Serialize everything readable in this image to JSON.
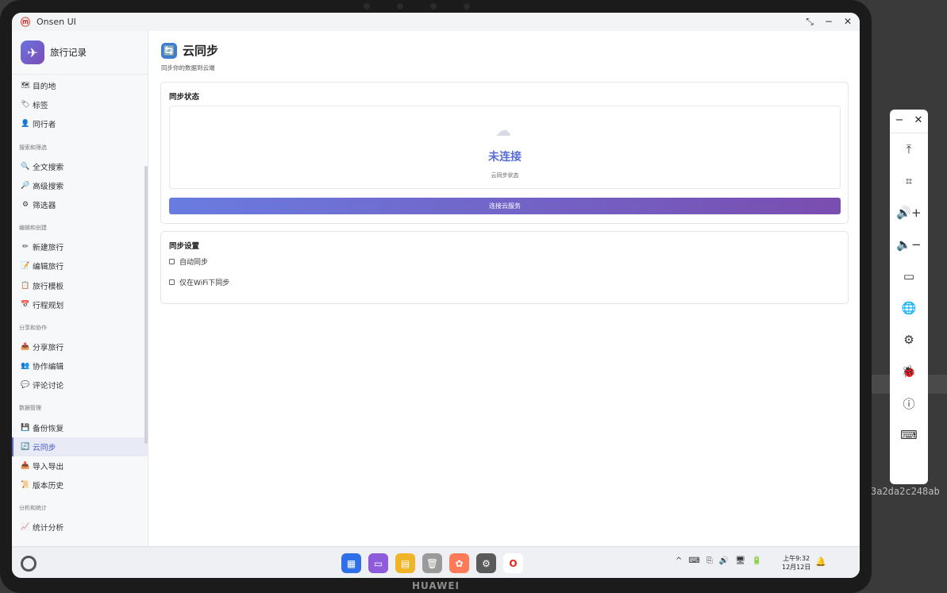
{
  "device": {
    "brand": "HUAWEI"
  },
  "window": {
    "title": "Onsen UI",
    "controls": [
      "⤡",
      "−",
      "✕"
    ]
  },
  "sidebar": {
    "app_title": "旅行记录",
    "sections": [
      {
        "label": "",
        "items": [
          {
            "icon": "🗺",
            "label": "目的地"
          },
          {
            "icon": "🏷",
            "label": "标签"
          },
          {
            "icon": "👤",
            "label": "同行者"
          }
        ]
      },
      {
        "label": "搜索和筛选",
        "items": [
          {
            "icon": "🔍",
            "label": "全文搜索"
          },
          {
            "icon": "🔎",
            "label": "高级搜索"
          },
          {
            "icon": "⚙",
            "label": "筛选器"
          }
        ]
      },
      {
        "label": "编辑和创建",
        "items": [
          {
            "icon": "✏",
            "label": "新建旅行"
          },
          {
            "icon": "📝",
            "label": "编辑旅行"
          },
          {
            "icon": "📋",
            "label": "旅行模板"
          },
          {
            "icon": "📅",
            "label": "行程规划"
          }
        ]
      },
      {
        "label": "分享和协作",
        "items": [
          {
            "icon": "📤",
            "label": "分享旅行"
          },
          {
            "icon": "👥",
            "label": "协作编辑"
          },
          {
            "icon": "💬",
            "label": "评论讨论"
          }
        ]
      },
      {
        "label": "数据管理",
        "items": [
          {
            "icon": "💾",
            "label": "备份恢复"
          },
          {
            "icon": "🔄",
            "label": "云同步",
            "active": true
          },
          {
            "icon": "📥",
            "label": "导入导出"
          },
          {
            "icon": "📜",
            "label": "版本历史"
          }
        ]
      },
      {
        "label": "分析和统计",
        "items": [
          {
            "icon": "📈",
            "label": "统计分析"
          }
        ]
      }
    ]
  },
  "main": {
    "title": "云同步",
    "title_icon": "🔄",
    "subtitle": "同步你的数据到云端",
    "sync_status": {
      "heading": "同步状态",
      "cloud_icon": "☁",
      "status": "未连接",
      "status_caption": "云同步状态",
      "button_label": "连接云服务"
    },
    "sync_settings": {
      "heading": "同步设置",
      "options": [
        {
          "label": "自动同步",
          "checked": false
        },
        {
          "label": "仅在WiFi下同步",
          "checked": false
        }
      ]
    }
  },
  "taskbar": {
    "dock": [
      {
        "name": "app-launcher",
        "color": "#2f6fe8",
        "glyph": "▦"
      },
      {
        "name": "multi-window",
        "color": "#8e5bdc",
        "glyph": "▭"
      },
      {
        "name": "notes",
        "color": "#f0b429",
        "glyph": "▤"
      },
      {
        "name": "trash",
        "color": "#9a9a9a",
        "glyph": "🗑"
      },
      {
        "name": "gallery",
        "color": "#ff7a59",
        "glyph": "✿"
      },
      {
        "name": "settings",
        "color": "#5a5a5a",
        "glyph": "⚙"
      },
      {
        "name": "onsen-app",
        "color": "#ffffff",
        "glyph": "O"
      }
    ],
    "tray": [
      "^",
      "⌨",
      "⎘",
      "🔊",
      "🖥",
      "🔋"
    ],
    "clock_time": "上午9:32",
    "clock_date": "12月12日"
  },
  "floating_toolbar": {
    "top": [
      "−",
      "✕"
    ],
    "items": [
      "⤒",
      "⌗",
      "🔊+",
      "🔈−",
      "▭",
      "🌐",
      "⚙",
      "🐞",
      "ⓘ",
      "⌨"
    ]
  },
  "background_text": "3a2da2c248ab"
}
